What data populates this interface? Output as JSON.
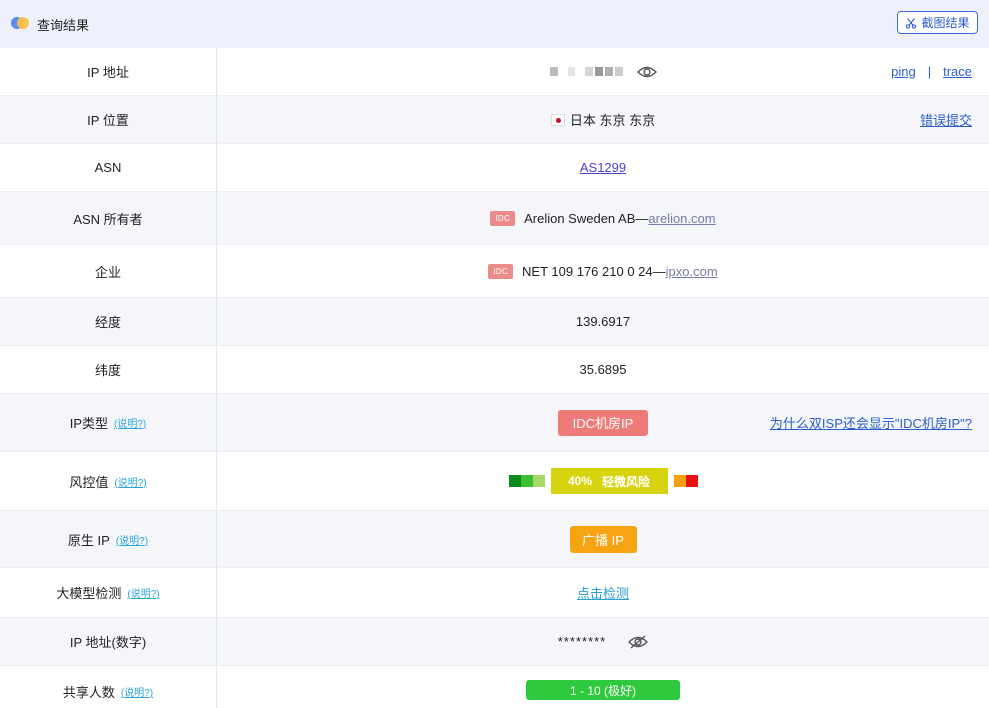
{
  "header": {
    "title": "查询结果",
    "screenshot_label": "截图结果"
  },
  "rows": {
    "ip": {
      "label": "IP 地址",
      "ping": "ping",
      "sep": "|",
      "trace": "trace"
    },
    "location": {
      "label": "IP 位置",
      "value": "日本 东京 东京",
      "report": "错误提交"
    },
    "asn": {
      "label": "ASN",
      "value": "AS1299"
    },
    "asn_owner": {
      "label": "ASN 所有者",
      "tag": "IDC",
      "name": "Arelion Sweden AB—",
      "domain": "arelion.com"
    },
    "company": {
      "label": "企业",
      "tag": "IDC",
      "name": "NET 109 176 210 0 24—",
      "domain": "ipxo.com"
    },
    "longitude": {
      "label": "经度",
      "value": "139.6917"
    },
    "latitude": {
      "label": "纬度",
      "value": "35.6895"
    },
    "ip_type": {
      "label": "IP类型",
      "help": "(说明?)",
      "badge": "IDC机房IP",
      "why": "为什么双ISP还会显示\"IDC机房IP\"?"
    },
    "risk": {
      "label": "风控值",
      "help": "(说明?)",
      "percent": "40%",
      "text": "轻微风险",
      "level": 0.4
    },
    "native_ip": {
      "label": "原生 IP",
      "help": "(说明?)",
      "badge": "广播 IP"
    },
    "llm": {
      "label": "大模型检测",
      "help": "(说明?)",
      "action": "点击检测"
    },
    "ip_number": {
      "label": "IP 地址(数字)",
      "value": "********"
    },
    "shared": {
      "label": "共享人数",
      "help": "(说明?)",
      "badge": "1 - 10 (极好)"
    }
  },
  "colors": {
    "risk_segments": [
      "#0a8a1a",
      "#3cbf2e",
      "#a6d86a"
    ],
    "risk_high": [
      "#f2a00c",
      "#e81010"
    ]
  }
}
